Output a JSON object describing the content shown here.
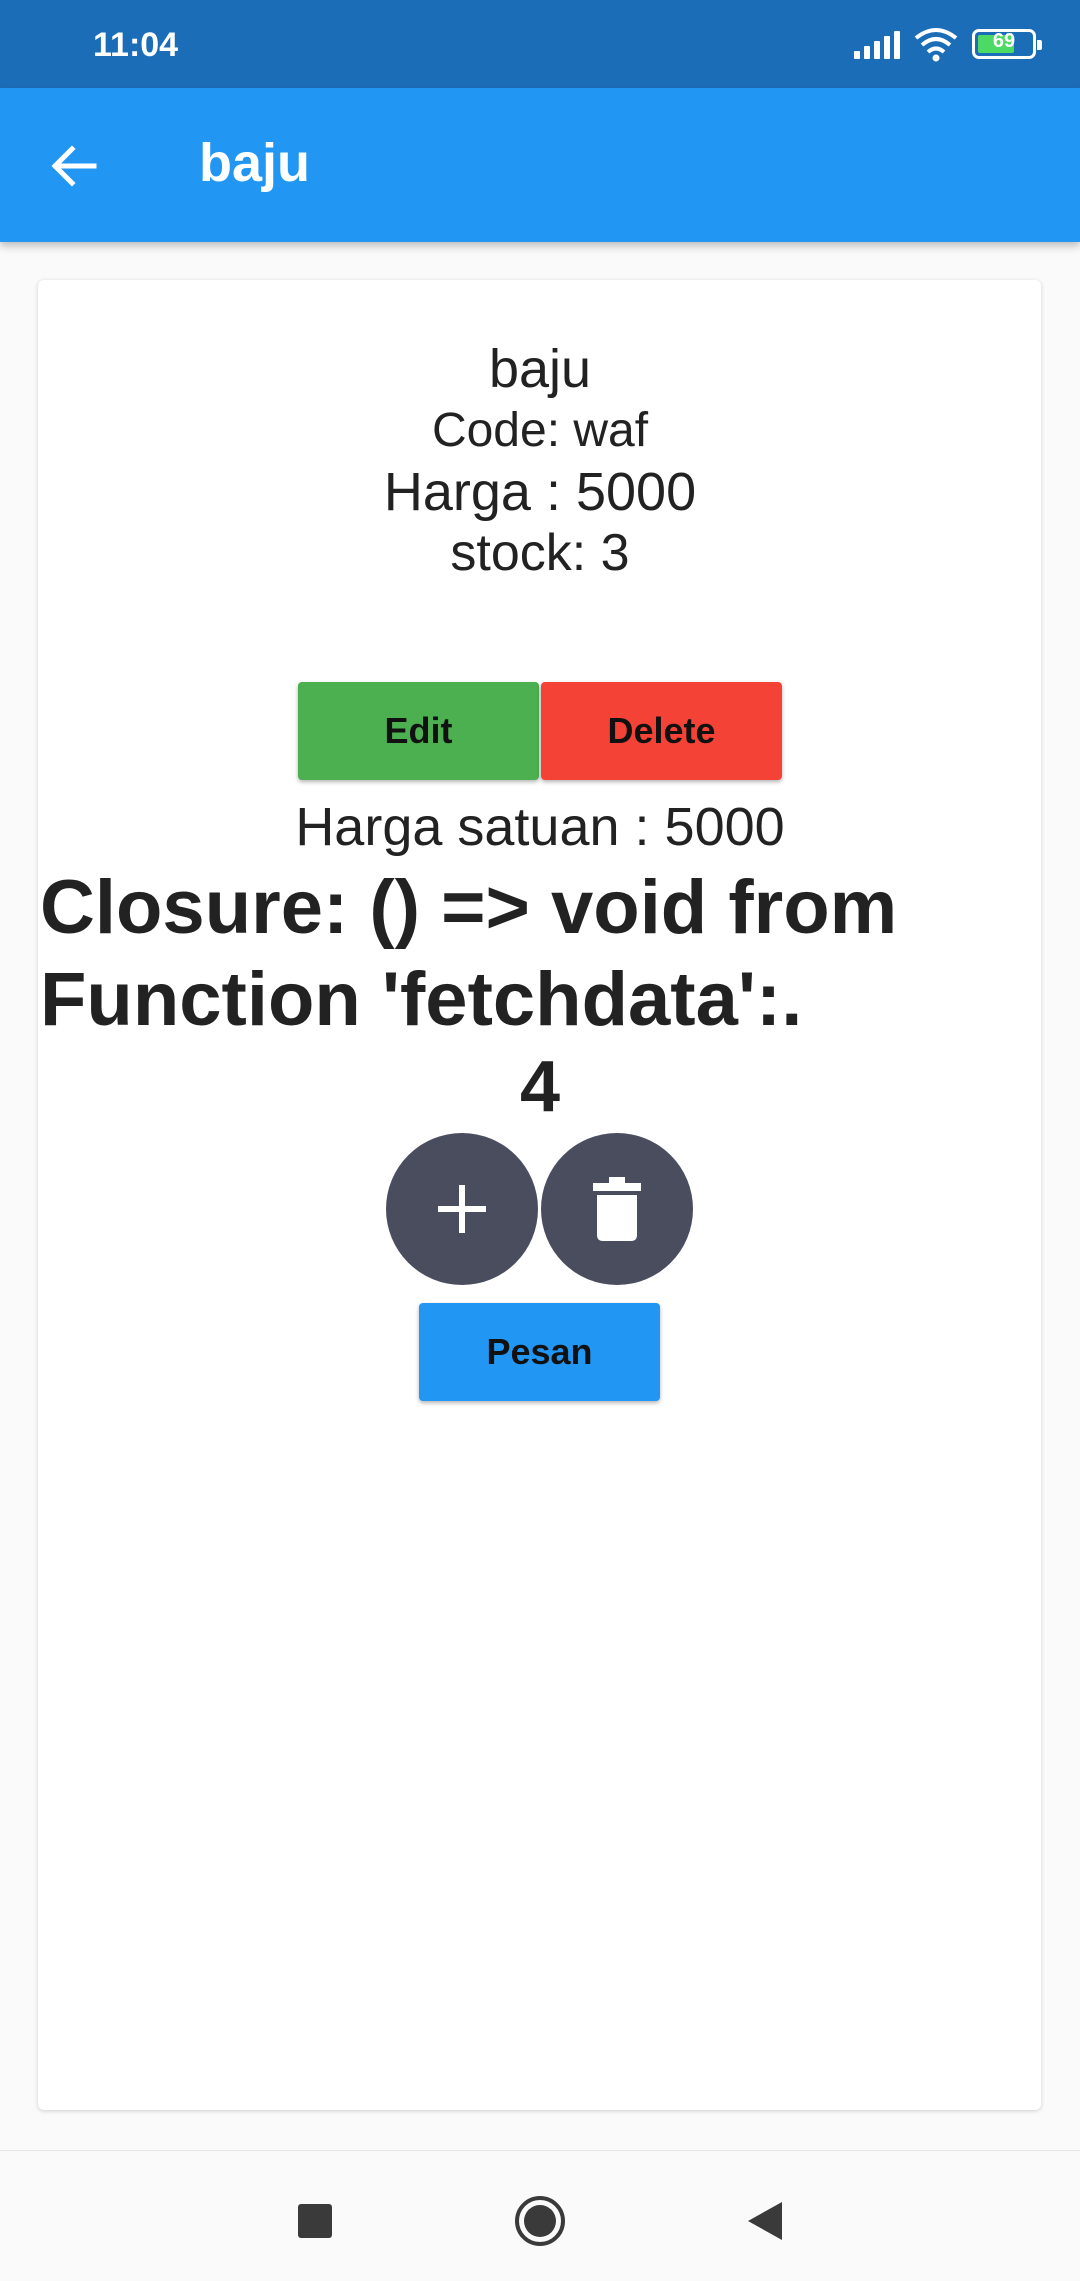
{
  "status_bar": {
    "time": "11:04",
    "battery_level": "69",
    "battery_fraction": 0.69,
    "icons": [
      "signal-icon",
      "wifi-icon",
      "battery-icon"
    ]
  },
  "app_bar": {
    "title": "baju",
    "back_icon": "arrow-back-icon",
    "color": "#2196f3"
  },
  "product": {
    "name": "baju",
    "code": "Code: waf",
    "price": "Harga : 5000",
    "stock": "stock: 3"
  },
  "actions": {
    "edit_label": "Edit",
    "edit_color": "#4caf50",
    "delete_label": "Delete",
    "delete_color": "#f44336"
  },
  "order": {
    "unit_price": "Harga satuan : 5000",
    "closure_text": "Closure: () => void from Function 'fetchdata':.",
    "quantity": "4",
    "add_icon": "plus-icon",
    "remove_icon": "trash-icon",
    "round_button_color": "#4a4d5e",
    "submit_label": "Pesan",
    "submit_color": "#2196f3"
  },
  "nav_bar": {
    "icons": [
      "recent-apps-icon",
      "home-icon",
      "back-icon"
    ]
  }
}
